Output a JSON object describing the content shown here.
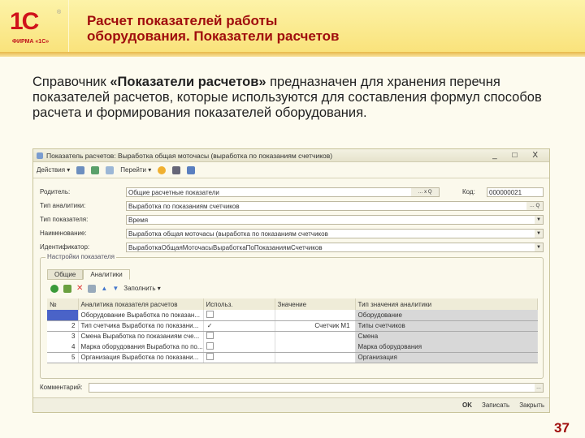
{
  "header": {
    "logo_text": "1С",
    "logo_sub": "ФИРМА «1С»",
    "title_line1": "Расчет показателей работы",
    "title_line2": "оборудования. Показатели расчетов"
  },
  "intro": {
    "part1": "Справочник ",
    "bold": "«Показатели расчетов»",
    "part2": " предназначен для хранения перечня показателей расчетов, которые используются для составления формул способов расчета и формирования показателей оборудования."
  },
  "window": {
    "title": "Показатель расчетов: Выработка общая моточасы (выработка по показаниям счетчиков)",
    "controls": "_ □ X",
    "toolbar": {
      "actions": "Действия ▾",
      "goto": "Перейти ▾"
    },
    "fields": [
      {
        "label": "Родитель:",
        "value": "Общие расчетные показатели"
      },
      {
        "label": "Тип аналитики:",
        "value": "Выработка по показаниям счетчиков"
      },
      {
        "label": "Тип показателя:",
        "value": "Время"
      },
      {
        "label": "Наименование:",
        "value": "Выработка общая моточасы (выработка по показаниям счетчиков"
      },
      {
        "label": "Идентификатор:",
        "value": "ВыработкаОбщаяМоточасыВыработкаПоПоказаниямСчетчиков"
      }
    ],
    "code_label": "Код:",
    "code_value": "000000021",
    "group_title": "Настройки показателя",
    "tabs": [
      "Общие",
      "Аналитики"
    ],
    "fill_label": "Заполнить ▾",
    "columns": [
      "№",
      "Аналитика показателя расчетов",
      "Использ.",
      "Значение",
      "Тип значения аналитики"
    ],
    "rows": [
      {
        "n": "",
        "name": "Оборудование Выработка по показан...",
        "used": false,
        "value": "",
        "type": "Оборудование"
      },
      {
        "n": "2",
        "name": "Тип счетчика Выработка по показани...",
        "used": true,
        "value": "Счетчик М1",
        "type": "Типы счетчиков"
      },
      {
        "n": "3",
        "name": "Смена Выработка по показаниям сче...",
        "used": false,
        "value": "",
        "type": "Смена"
      },
      {
        "n": "4",
        "name": "Марка оборудования Выработка по по...",
        "used": false,
        "value": "",
        "type": "Марка оборудования"
      },
      {
        "n": "5",
        "name": "Организация Выработка по показани...",
        "used": false,
        "value": "",
        "type": "Организация"
      }
    ],
    "comment_label": "Комментарий:",
    "comment_value": "",
    "buttons": {
      "ok": "OK",
      "save": "Записать",
      "close": "Закрыть"
    }
  },
  "page_number": "37",
  "colors": {
    "title": "#a00d0d",
    "header_bg": "#f9e27a",
    "selected_row": "#4a63c8"
  }
}
